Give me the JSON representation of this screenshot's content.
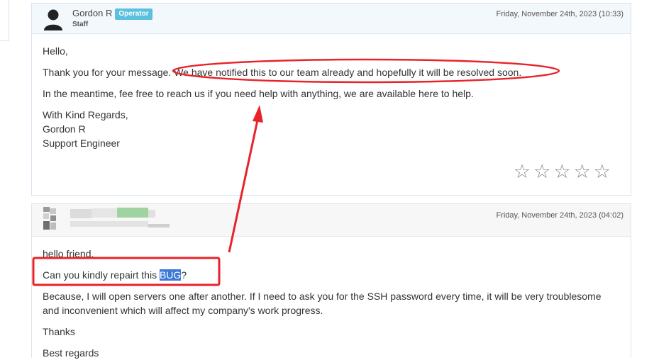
{
  "staff_message": {
    "author": "Gordon R",
    "badge": "Operator",
    "role": "Staff",
    "date": "Friday, November 24th, 2023 (10:33)",
    "greeting": "Hello,",
    "line1_a": "Thank you for your message.",
    "line1_b": "We have notified this to our team already and hopefully it will be resolved soon.",
    "line2": "In the meantime, fee free to reach us if you need help with anything, we are available here to help.",
    "sign1": "With Kind Regards,",
    "sign2": "Gordon R",
    "sign3": "Support Engineer",
    "rating_stars": 5,
    "rating_value": 0,
    "star_char": "☆"
  },
  "client_message": {
    "date": "Friday, November 24th, 2023 (04:02)",
    "greeting": "hello friend,",
    "line1_a": "Can you kindly repairt this",
    "line1_hl": "BUG",
    "line1_b": "?",
    "line2": "Because, I will open servers one after another. If I need to ask you for the SSH password every time, it will be very troublesome and inconvenient which will affect my company's work progress.",
    "thanks": "Thanks",
    "regards": "Best regards"
  },
  "colors": {
    "annotation": "#e8232a",
    "badge": "#5bc0de",
    "highlight": "#3b78d8"
  }
}
